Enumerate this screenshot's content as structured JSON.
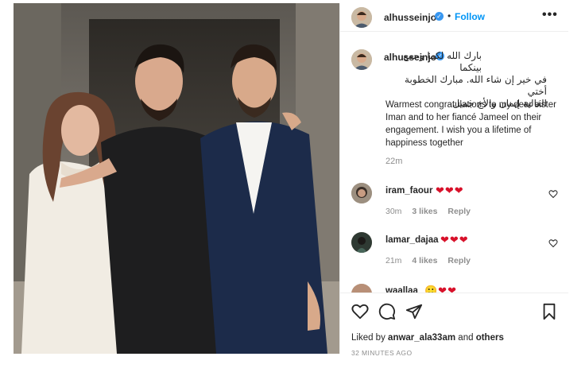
{
  "post": {
    "author": "alhusseinjo",
    "follow_label": "Follow",
    "separator": "•",
    "more_label": "•••",
    "verified_mark": "✓",
    "caption": {
      "arabic_lines": [
        "بارك الله لكما وجمع بينكما",
        "في خير إن شاء الله. مبارك الخطوبة أختي",
        "الغالية إيمان والأخ جميل"
      ],
      "english": "Warmest congratulations to my dear sister Iman and to her fiancé Jameel on their engagement. I wish you a lifetime of happiness together",
      "time": "22m"
    },
    "comments": [
      {
        "user": "iram_faour",
        "hearts": "❤❤❤",
        "time": "30m",
        "likes": "3 likes",
        "reply": "Reply"
      },
      {
        "user": "lamar_dajaa",
        "hearts": "❤❤❤",
        "time": "21m",
        "likes": "4 likes",
        "reply": "Reply"
      },
      {
        "user": "waallaa",
        "hearts": "🙂❤❤",
        "time": "",
        "likes": "",
        "reply": ""
      }
    ],
    "liked_by": {
      "prefix": "Liked by",
      "user": "anwar_ala33am",
      "and": "and",
      "others": "others"
    },
    "posted_ago": "32 MINUTES AGO"
  },
  "icons": {
    "like": "heart-outline-icon",
    "comment": "speech-bubble-icon",
    "share": "paper-plane-icon",
    "save": "bookmark-icon"
  },
  "colors": {
    "accent": "#0095f6",
    "verified": "#3897f0",
    "heart": "#d8112a",
    "muted": "#8e8e8e"
  }
}
